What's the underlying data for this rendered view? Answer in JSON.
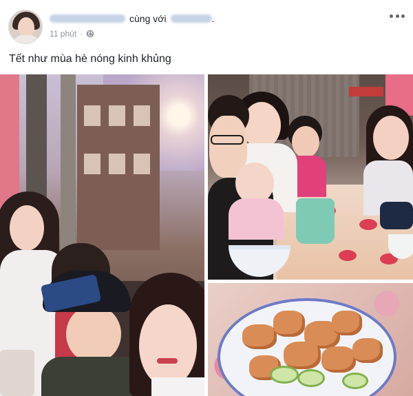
{
  "post": {
    "with_text": "cùng với",
    "time": "11 phút",
    "dot": "·",
    "caption": "Tết như mùa hè nóng kinh khủng",
    "privacy_icon": "globe-icon",
    "menu_icon": "more-options-icon"
  },
  "colors": {
    "meta_gray": "#90949c",
    "text": "#1d2129",
    "blur_name": "#c6d2e6"
  }
}
